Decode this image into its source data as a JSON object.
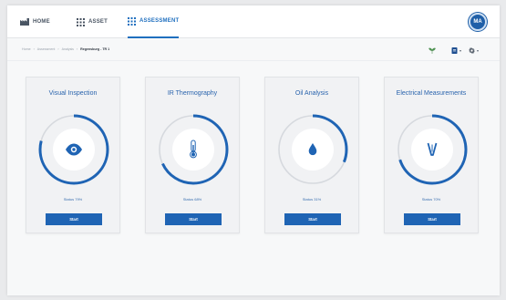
{
  "header": {
    "nav": [
      {
        "label": "HOME",
        "icon": "factory-icon"
      },
      {
        "label": "ASSET",
        "icon": "grid-icon"
      },
      {
        "label": "ASSESSMENT",
        "icon": "grid-icon",
        "active": true
      }
    ],
    "avatar_initials": "MA"
  },
  "breadcrumb": {
    "items": [
      "Home",
      "Assessment",
      "Analysis",
      "Regensburg - TR 1"
    ]
  },
  "toolbar": {
    "icons": [
      "plant-icon",
      "document-icon",
      "gear-icon"
    ]
  },
  "colors": {
    "accent": "#1f64b4",
    "ring_track": "#d6d9de",
    "card_bg": "#f1f2f4"
  },
  "cards": [
    {
      "title": "Visual Inspection",
      "icon": "eye-icon",
      "status_label": "Status 79%",
      "progress": 0.79,
      "button_label": "Start"
    },
    {
      "title": "IR Thermography",
      "icon": "thermometer-icon",
      "status_label": "Status 68%",
      "progress": 0.68,
      "button_label": "Start"
    },
    {
      "title": "Oil Analysis",
      "icon": "oil-drop-icon",
      "status_label": "Status 31%",
      "progress": 0.31,
      "button_label": "Start"
    },
    {
      "title": "Electrical Measurements",
      "icon": "meter-probe-icon",
      "status_label": "Status 70%",
      "progress": 0.7,
      "button_label": "Start"
    }
  ]
}
